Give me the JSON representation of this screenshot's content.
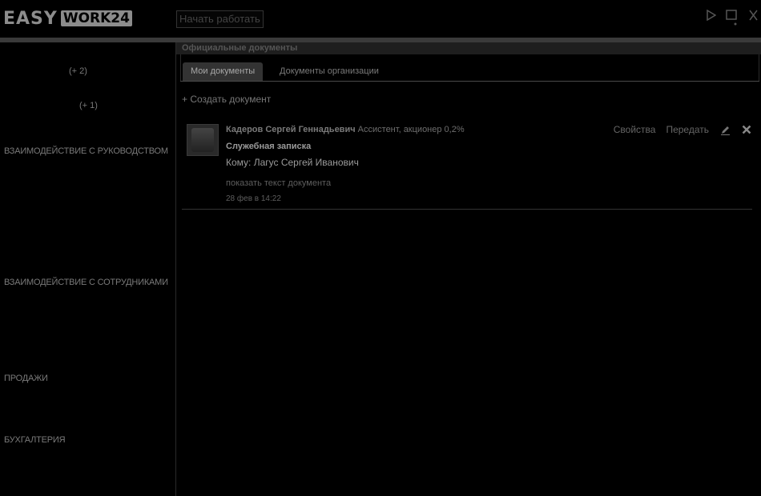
{
  "header": {
    "logo_left": "EASY",
    "logo_right": "WORK24",
    "start_button": "Начать работать"
  },
  "sidebar": {
    "counts": [
      "(+ 2)",
      "(+ 1)"
    ],
    "items": [
      {
        "label": "ВЗАИМОДЕЙСТВИЕ С РУКОВОДСТВОМ"
      },
      {
        "label": "ВЗАИМОДЕЙСТВИЕ С СОТРУДНИКАМИ"
      },
      {
        "label": "ПРОДАЖИ"
      },
      {
        "label": "БУХГАЛТЕРИЯ"
      }
    ]
  },
  "panel": {
    "title": "Официальные документы",
    "tabs": [
      {
        "label": "Мои документы",
        "active": true
      },
      {
        "label": "Документы организации",
        "active": false
      }
    ],
    "create_link": "+ Создать документ"
  },
  "document": {
    "author": "Кадеров Сергей Геннадьевич",
    "author_role": "Ассистент, акционер 0,2%",
    "type": "Служебная записка",
    "recipient": "Кому: Лагус Сергей Иванович",
    "show_text": "показать текст документа",
    "date": "28 фев в 14:22",
    "actions": {
      "properties": "Свойства",
      "transfer": "Передать"
    },
    "icons": [
      "edit-icon",
      "delete-icon"
    ]
  }
}
